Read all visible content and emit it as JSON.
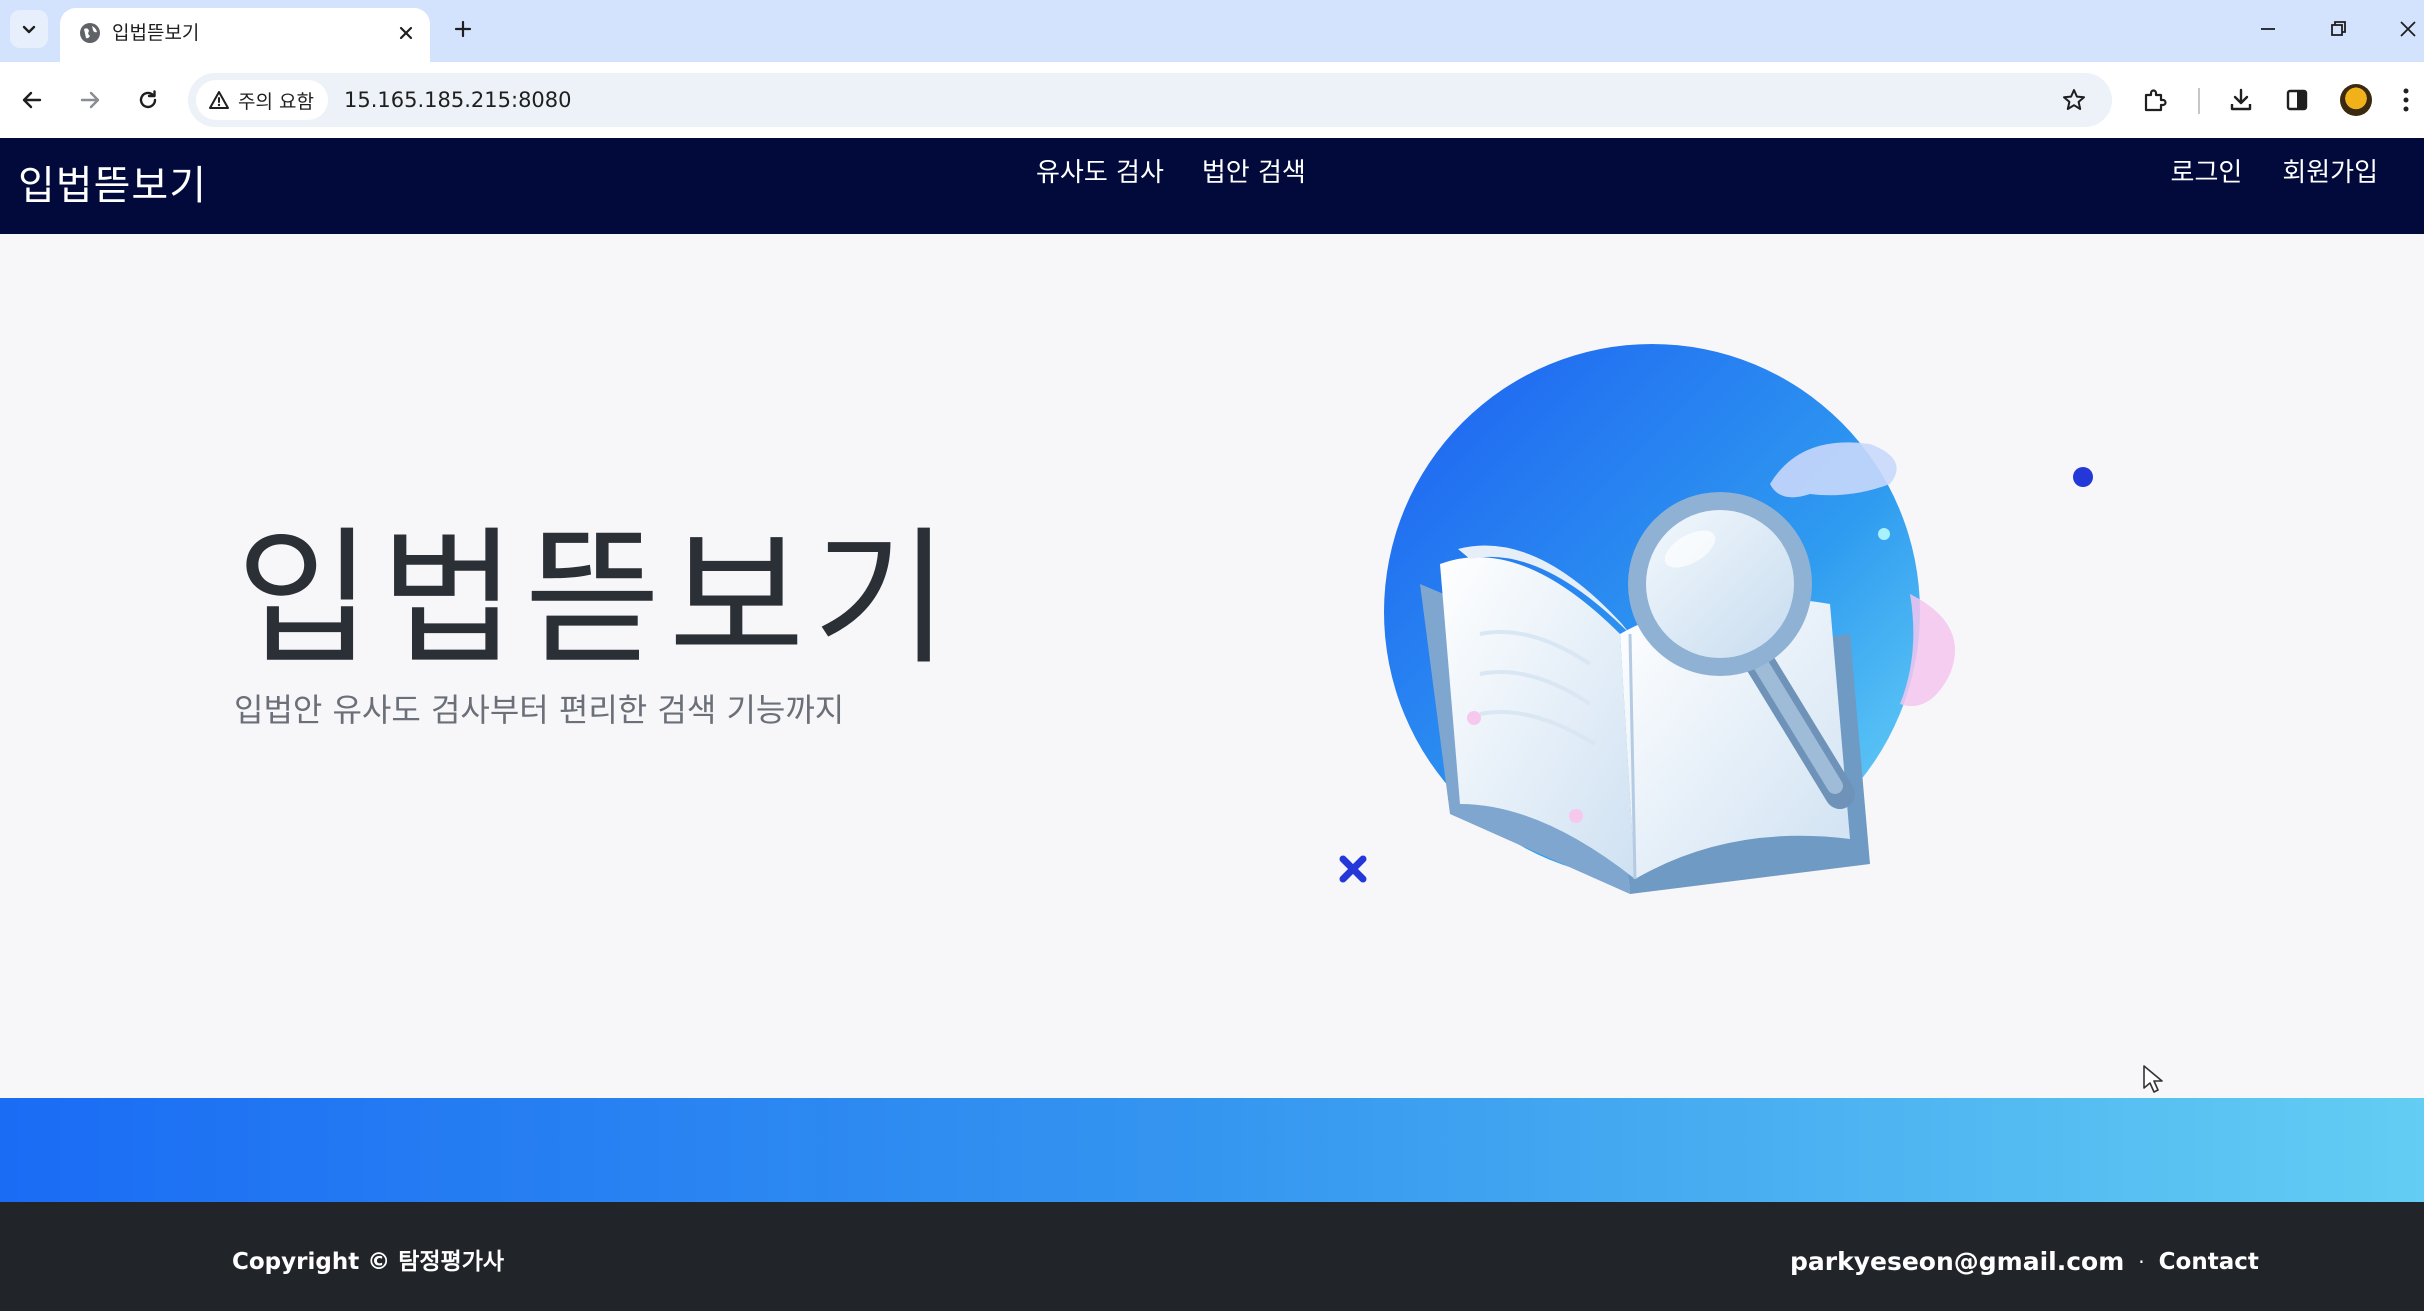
{
  "browser": {
    "tab_title": "입법뜯보기",
    "security_label": "주의 요함",
    "url": "15.165.185.215:8080"
  },
  "header": {
    "brand": "입법뜯보기",
    "nav": [
      "유사도 검사",
      "법안 검색"
    ],
    "auth": [
      "로그인",
      "회원가입"
    ]
  },
  "hero": {
    "title": "입법뜯보기",
    "subtitle": "입법안 유사도 검사부터 편리한 검색 기능까지"
  },
  "footer": {
    "copyright": "Copyright © 탐정평가사",
    "email": "parkyeseon@gmail.com",
    "separator": "·",
    "contact": "Contact"
  },
  "colors": {
    "header_bg": "#010a3a",
    "gradient_start": "#1a6cf4",
    "gradient_end": "#63cdf3",
    "footer_bg": "#212529",
    "tabbar_bg": "#d3e3fd"
  }
}
